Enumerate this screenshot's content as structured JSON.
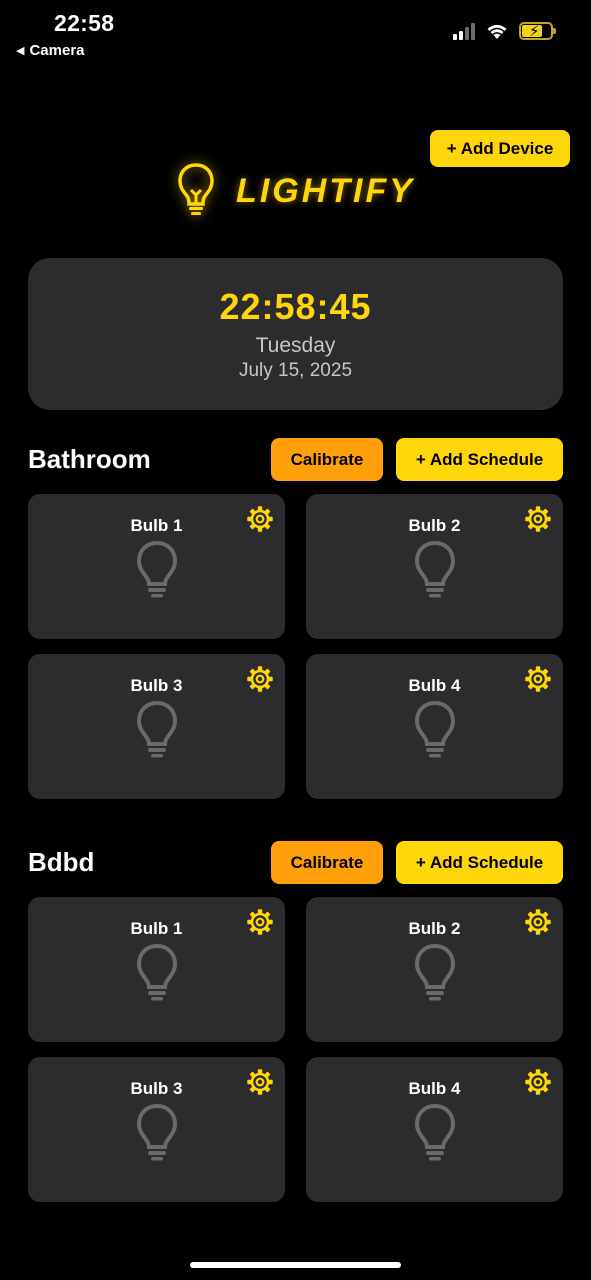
{
  "status_bar": {
    "time": "22:58",
    "back_label": "Camera"
  },
  "header": {
    "add_device_label": "+ Add Device",
    "brand_name": "LIGHTIFY",
    "accent_color": "#ffd60a"
  },
  "clock": {
    "time": "22:58:45",
    "day": "Tuesday",
    "date": "July 15, 2025"
  },
  "rooms": [
    {
      "name": "Bathroom",
      "calibrate_label": "Calibrate",
      "schedule_label": "+ Add Schedule",
      "bulbs": [
        {
          "name": "Bulb 1",
          "state": "off"
        },
        {
          "name": "Bulb 2",
          "state": "off"
        },
        {
          "name": "Bulb 3",
          "state": "off"
        },
        {
          "name": "Bulb 4",
          "state": "off"
        }
      ]
    },
    {
      "name": "Bdbd",
      "calibrate_label": "Calibrate",
      "schedule_label": "+ Add Schedule",
      "bulbs": [
        {
          "name": "Bulb 1",
          "state": "off"
        },
        {
          "name": "Bulb 2",
          "state": "off"
        },
        {
          "name": "Bulb 3",
          "state": "off"
        },
        {
          "name": "Bulb 4",
          "state": "off"
        }
      ]
    }
  ]
}
